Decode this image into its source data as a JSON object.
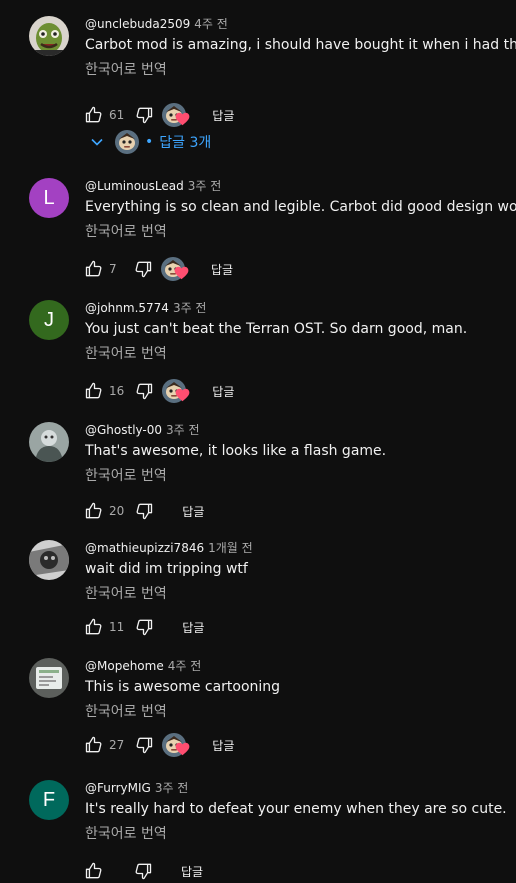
{
  "colors": {
    "background": "#0f0f0f",
    "text": "#f1f1f1",
    "secondary": "#aaaaaa",
    "link": "#3ea6ff",
    "heart": "#ff4e70"
  },
  "comments": [
    {
      "author": "@unclebuda2509",
      "time": "4주 전",
      "text": "Carbot mod is amazing, i should have bought it when i had the chance",
      "translate": "한국어로 번역",
      "likes": "61",
      "heart": true,
      "reply_label": "답글",
      "avatar": {
        "type": "photo",
        "name": "green-monster-avatar"
      }
    },
    {
      "author": "@LuminousLead",
      "time": "3주 전",
      "text": "Everything is so clean and legible.  Carbot did good design work.",
      "translate": "한국어로 번역",
      "likes": "7",
      "heart": true,
      "reply_label": "답글",
      "avatar": {
        "type": "letter",
        "letter": "L",
        "color": "#a341c2"
      }
    },
    {
      "author": "@johnm.5774",
      "time": "3주 전",
      "text": "You just can't beat the Terran OST. So darn good, man.",
      "translate": "한국어로 번역",
      "likes": "16",
      "heart": true,
      "reply_label": "답글",
      "avatar": {
        "type": "letter",
        "letter": "J",
        "color": "#33691e"
      }
    },
    {
      "author": "@Ghostly-00",
      "time": "3주 전",
      "text": "That's awesome, it looks like a flash game.",
      "translate": "한국어로 번역",
      "likes": "20",
      "heart": false,
      "reply_label": "답글",
      "avatar": {
        "type": "photo",
        "name": "ghostly-avatar"
      }
    },
    {
      "author": "@mathieupizzi7846",
      "time": "1개월 전",
      "text": "wait did im tripping wtf",
      "translate": "한국어로 번역",
      "likes": "11",
      "heart": false,
      "reply_label": "답글",
      "avatar": {
        "type": "photo",
        "name": "mathieu-avatar"
      }
    },
    {
      "author": "@Mopehome",
      "time": "4주 전",
      "text": "This is awesome cartooning",
      "translate": "한국어로 번역",
      "likes": "27",
      "heart": true,
      "reply_label": "답글",
      "avatar": {
        "type": "photo",
        "name": "mopehome-avatar"
      }
    },
    {
      "author": "@FurryMIG",
      "time": "3주 전",
      "text": "It's really hard to defeat your enemy when they are so cute.",
      "translate": "한국어로 번역",
      "likes": "",
      "heart": false,
      "reply_label": "답글",
      "avatar": {
        "type": "letter",
        "letter": "F",
        "color": "#00695c"
      }
    }
  ],
  "replies_toggle": {
    "separator": "•",
    "label": "답글 3개"
  }
}
